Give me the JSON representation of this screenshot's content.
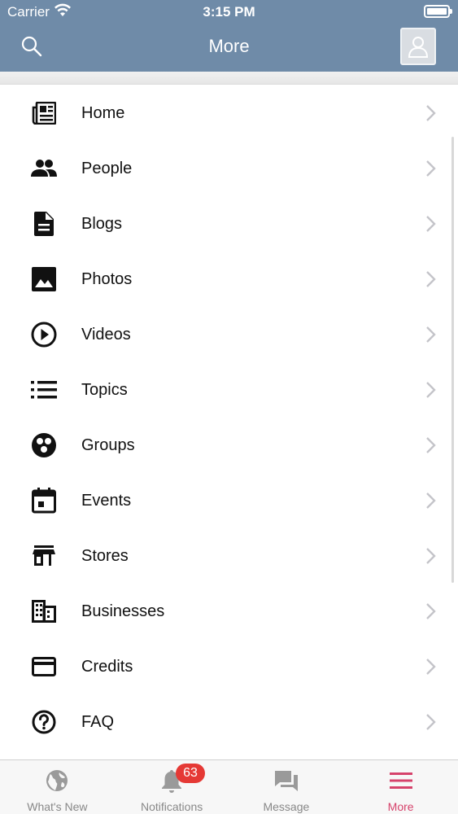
{
  "status_bar": {
    "carrier": "Carrier",
    "time": "3:15 PM"
  },
  "nav": {
    "title": "More"
  },
  "menu": {
    "items": [
      {
        "label": "Home",
        "icon": "newspaper-icon"
      },
      {
        "label": "People",
        "icon": "people-icon"
      },
      {
        "label": "Blogs",
        "icon": "document-icon"
      },
      {
        "label": "Photos",
        "icon": "photo-icon"
      },
      {
        "label": "Videos",
        "icon": "play-circle-icon"
      },
      {
        "label": "Topics",
        "icon": "list-icon"
      },
      {
        "label": "Groups",
        "icon": "groups-icon"
      },
      {
        "label": "Events",
        "icon": "calendar-icon"
      },
      {
        "label": "Stores",
        "icon": "store-icon"
      },
      {
        "label": "Businesses",
        "icon": "building-icon"
      },
      {
        "label": "Credits",
        "icon": "credit-card-icon"
      },
      {
        "label": "FAQ",
        "icon": "help-circle-icon"
      }
    ]
  },
  "tabbar": {
    "tabs": [
      {
        "label": "What's New",
        "icon": "globe-icon"
      },
      {
        "label": "Notifications",
        "icon": "bell-icon"
      },
      {
        "label": "Message",
        "icon": "chat-icon"
      },
      {
        "label": "More",
        "icon": "menu-icon"
      }
    ],
    "notifications_badge": "63",
    "active_tab": "More"
  },
  "colors": {
    "header": "#6f8ba8",
    "active_tab": "#d6426b",
    "badge": "#e53935"
  }
}
